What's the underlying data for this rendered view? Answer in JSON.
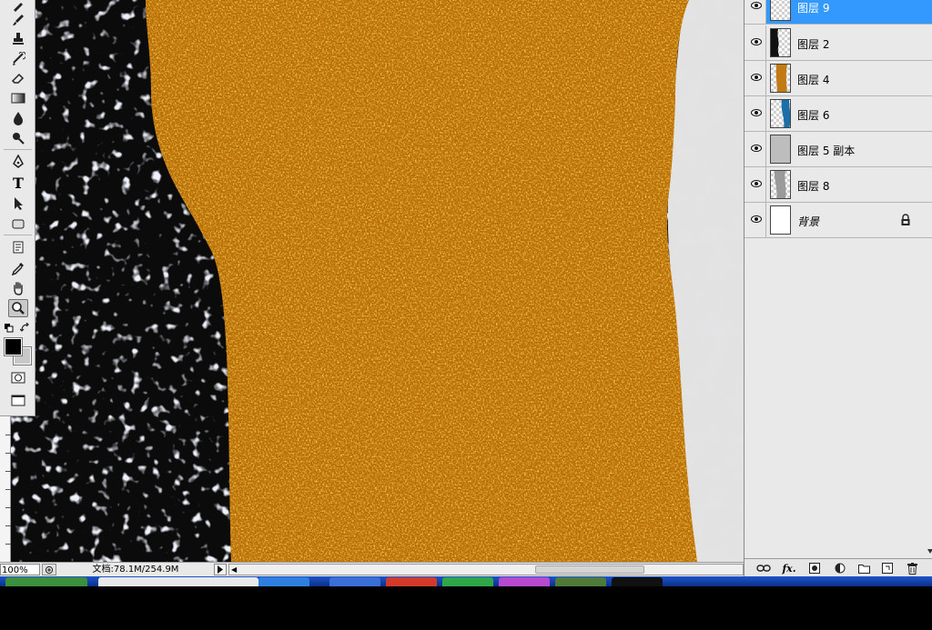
{
  "toolbox": {
    "tools": [
      {
        "name": "pencil-tool-icon"
      },
      {
        "name": "brush-tool-icon"
      },
      {
        "name": "clone-stamp-tool-icon"
      },
      {
        "name": "history-brush-tool-icon"
      },
      {
        "name": "eraser-tool-icon"
      },
      {
        "name": "gradient-tool-icon"
      },
      {
        "name": "blur-tool-icon"
      },
      {
        "name": "dodge-tool-icon"
      },
      {
        "name": "pen-tool-icon"
      },
      {
        "name": "type-tool-icon"
      },
      {
        "name": "path-selection-tool-icon"
      },
      {
        "name": "shape-tool-icon"
      },
      {
        "name": "notes-tool-icon"
      },
      {
        "name": "eyedropper-tool-icon"
      },
      {
        "name": "hand-tool-icon"
      },
      {
        "name": "zoom-tool-icon"
      }
    ],
    "type_glyph": "T",
    "foreground_color": "#000000",
    "background_color": "#c8c8c8"
  },
  "status": {
    "zoom": "100%",
    "doc_info": "文档:78.1M/254.9M"
  },
  "layers": [
    {
      "name": "图层 9",
      "selected": true,
      "visible": true,
      "thumb": "checker"
    },
    {
      "name": "图层 2",
      "selected": false,
      "visible": true,
      "thumb": "checker-dark"
    },
    {
      "name": "图层 4",
      "selected": false,
      "visible": true,
      "thumb": "checker-orange"
    },
    {
      "name": "图层 6",
      "selected": false,
      "visible": true,
      "thumb": "checker-blue"
    },
    {
      "name": "图层 5 副本",
      "selected": false,
      "visible": true,
      "thumb": "gray"
    },
    {
      "name": "图层 8",
      "selected": false,
      "visible": true,
      "thumb": "checker-gray"
    },
    {
      "name": "背景",
      "selected": false,
      "visible": true,
      "thumb": "white",
      "locked": true
    }
  ],
  "panel_footer": {
    "fx_label": "fx."
  },
  "colors": {
    "selection": "#3399ff",
    "gold": "#d9900c",
    "paper": "#dcdcdc",
    "taskbar": "#1d55c9"
  }
}
